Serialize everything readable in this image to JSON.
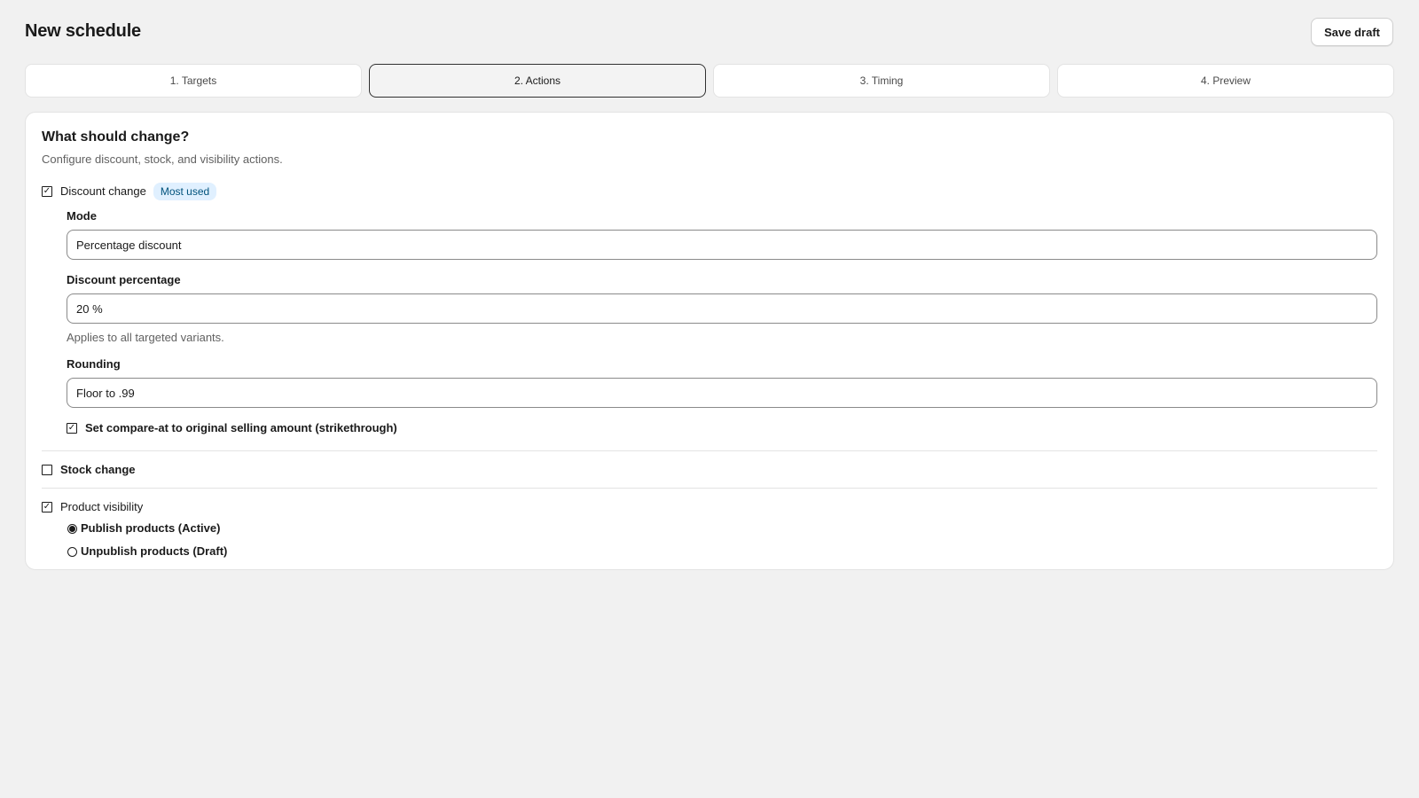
{
  "header": {
    "title": "New schedule",
    "save_label": "Save draft"
  },
  "steps": [
    {
      "label": "1. Targets",
      "active": false
    },
    {
      "label": "2. Actions",
      "active": true
    },
    {
      "label": "3. Timing",
      "active": false
    },
    {
      "label": "4. Preview",
      "active": false
    }
  ],
  "card": {
    "title": "What should change?",
    "subtitle": "Configure discount, stock, and visibility actions."
  },
  "discount": {
    "label": "Discount change",
    "checked": true,
    "badge": "Most used",
    "mode_label": "Mode",
    "mode_value": "Percentage discount",
    "percentage_label": "Discount percentage",
    "percentage_value": "20 %",
    "percentage_help": "Applies to all targeted variants.",
    "rounding_label": "Rounding",
    "rounding_value": "Floor to .99",
    "compare_label": "Set compare-at to original selling amount (strikethrough)",
    "compare_checked": true
  },
  "stock": {
    "label": "Stock change",
    "checked": false
  },
  "visibility": {
    "label": "Product visibility",
    "checked": true,
    "options": [
      {
        "label": "Publish products (Active)",
        "selected": true
      },
      {
        "label": "Unpublish products (Draft)",
        "selected": false
      }
    ]
  },
  "colors": {
    "background": "#f1f1f1",
    "card": "#ffffff",
    "badge_bg": "#e0f0ff",
    "badge_text": "#00527c",
    "text": "#1a1a1a",
    "muted": "#616161"
  },
  "icons": {
    "checked": "checkbox-checked-icon",
    "unchecked": "checkbox-unchecked-icon",
    "radio_on": "radio-selected-icon",
    "radio_off": "radio-unselected-icon"
  }
}
